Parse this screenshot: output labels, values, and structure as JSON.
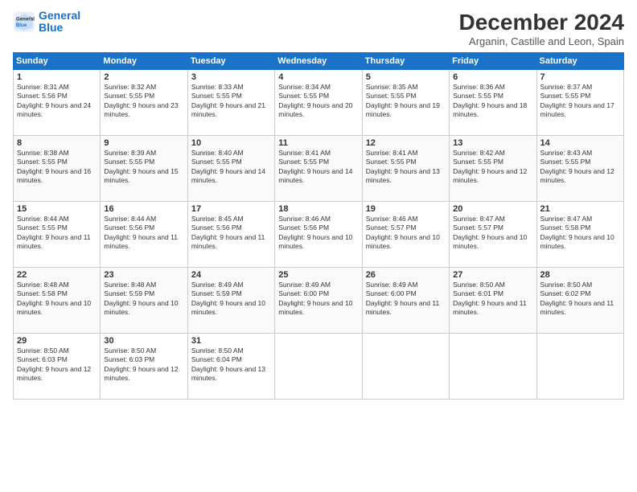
{
  "header": {
    "logo_line1": "General",
    "logo_line2": "Blue",
    "month": "December 2024",
    "location": "Arganin, Castille and Leon, Spain"
  },
  "weekdays": [
    "Sunday",
    "Monday",
    "Tuesday",
    "Wednesday",
    "Thursday",
    "Friday",
    "Saturday"
  ],
  "weeks": [
    [
      {
        "day": 1,
        "sunrise": "8:31 AM",
        "sunset": "5:56 PM",
        "daylight": "9 hours and 24 minutes."
      },
      {
        "day": 2,
        "sunrise": "8:32 AM",
        "sunset": "5:55 PM",
        "daylight": "9 hours and 23 minutes."
      },
      {
        "day": 3,
        "sunrise": "8:33 AM",
        "sunset": "5:55 PM",
        "daylight": "9 hours and 21 minutes."
      },
      {
        "day": 4,
        "sunrise": "8:34 AM",
        "sunset": "5:55 PM",
        "daylight": "9 hours and 20 minutes."
      },
      {
        "day": 5,
        "sunrise": "8:35 AM",
        "sunset": "5:55 PM",
        "daylight": "9 hours and 19 minutes."
      },
      {
        "day": 6,
        "sunrise": "8:36 AM",
        "sunset": "5:55 PM",
        "daylight": "9 hours and 18 minutes."
      },
      {
        "day": 7,
        "sunrise": "8:37 AM",
        "sunset": "5:55 PM",
        "daylight": "9 hours and 17 minutes."
      }
    ],
    [
      {
        "day": 8,
        "sunrise": "8:38 AM",
        "sunset": "5:55 PM",
        "daylight": "9 hours and 16 minutes."
      },
      {
        "day": 9,
        "sunrise": "8:39 AM",
        "sunset": "5:55 PM",
        "daylight": "9 hours and 15 minutes."
      },
      {
        "day": 10,
        "sunrise": "8:40 AM",
        "sunset": "5:55 PM",
        "daylight": "9 hours and 14 minutes."
      },
      {
        "day": 11,
        "sunrise": "8:41 AM",
        "sunset": "5:55 PM",
        "daylight": "9 hours and 14 minutes."
      },
      {
        "day": 12,
        "sunrise": "8:41 AM",
        "sunset": "5:55 PM",
        "daylight": "9 hours and 13 minutes."
      },
      {
        "day": 13,
        "sunrise": "8:42 AM",
        "sunset": "5:55 PM",
        "daylight": "9 hours and 12 minutes."
      },
      {
        "day": 14,
        "sunrise": "8:43 AM",
        "sunset": "5:55 PM",
        "daylight": "9 hours and 12 minutes."
      }
    ],
    [
      {
        "day": 15,
        "sunrise": "8:44 AM",
        "sunset": "5:55 PM",
        "daylight": "9 hours and 11 minutes."
      },
      {
        "day": 16,
        "sunrise": "8:44 AM",
        "sunset": "5:56 PM",
        "daylight": "9 hours and 11 minutes."
      },
      {
        "day": 17,
        "sunrise": "8:45 AM",
        "sunset": "5:56 PM",
        "daylight": "9 hours and 11 minutes."
      },
      {
        "day": 18,
        "sunrise": "8:46 AM",
        "sunset": "5:56 PM",
        "daylight": "9 hours and 10 minutes."
      },
      {
        "day": 19,
        "sunrise": "8:46 AM",
        "sunset": "5:57 PM",
        "daylight": "9 hours and 10 minutes."
      },
      {
        "day": 20,
        "sunrise": "8:47 AM",
        "sunset": "5:57 PM",
        "daylight": "9 hours and 10 minutes."
      },
      {
        "day": 21,
        "sunrise": "8:47 AM",
        "sunset": "5:58 PM",
        "daylight": "9 hours and 10 minutes."
      }
    ],
    [
      {
        "day": 22,
        "sunrise": "8:48 AM",
        "sunset": "5:58 PM",
        "daylight": "9 hours and 10 minutes."
      },
      {
        "day": 23,
        "sunrise": "8:48 AM",
        "sunset": "5:59 PM",
        "daylight": "9 hours and 10 minutes."
      },
      {
        "day": 24,
        "sunrise": "8:49 AM",
        "sunset": "5:59 PM",
        "daylight": "9 hours and 10 minutes."
      },
      {
        "day": 25,
        "sunrise": "8:49 AM",
        "sunset": "6:00 PM",
        "daylight": "9 hours and 10 minutes."
      },
      {
        "day": 26,
        "sunrise": "8:49 AM",
        "sunset": "6:00 PM",
        "daylight": "9 hours and 11 minutes."
      },
      {
        "day": 27,
        "sunrise": "8:50 AM",
        "sunset": "6:01 PM",
        "daylight": "9 hours and 11 minutes."
      },
      {
        "day": 28,
        "sunrise": "8:50 AM",
        "sunset": "6:02 PM",
        "daylight": "9 hours and 11 minutes."
      }
    ],
    [
      {
        "day": 29,
        "sunrise": "8:50 AM",
        "sunset": "6:03 PM",
        "daylight": "9 hours and 12 minutes."
      },
      {
        "day": 30,
        "sunrise": "8:50 AM",
        "sunset": "6:03 PM",
        "daylight": "9 hours and 12 minutes."
      },
      {
        "day": 31,
        "sunrise": "8:50 AM",
        "sunset": "6:04 PM",
        "daylight": "9 hours and 13 minutes."
      },
      null,
      null,
      null,
      null
    ]
  ]
}
